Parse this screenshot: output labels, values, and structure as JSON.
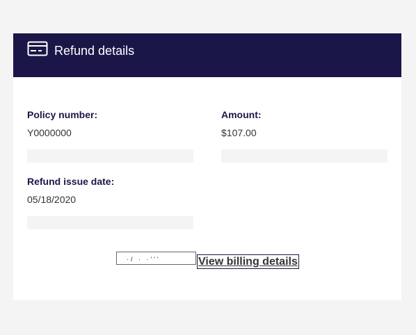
{
  "header": {
    "title": "Refund details",
    "icon": "credit-card-icon",
    "background": "#1a1748"
  },
  "fields": {
    "policy_number": {
      "label": "Policy number:",
      "value": "Y0000000"
    },
    "amount": {
      "label": "Amount:",
      "value": "$107.00"
    },
    "refund_issue_date": {
      "label": "Refund issue date:",
      "value": "05/18/2020"
    }
  },
  "actions": {
    "broken_button_text": "·/ · ·ʹʹʹ",
    "view_billing_details": "View billing details"
  },
  "colors": {
    "page_background": "#f4f4f4",
    "card_background": "#ffffff",
    "accent": "#1a1748"
  }
}
